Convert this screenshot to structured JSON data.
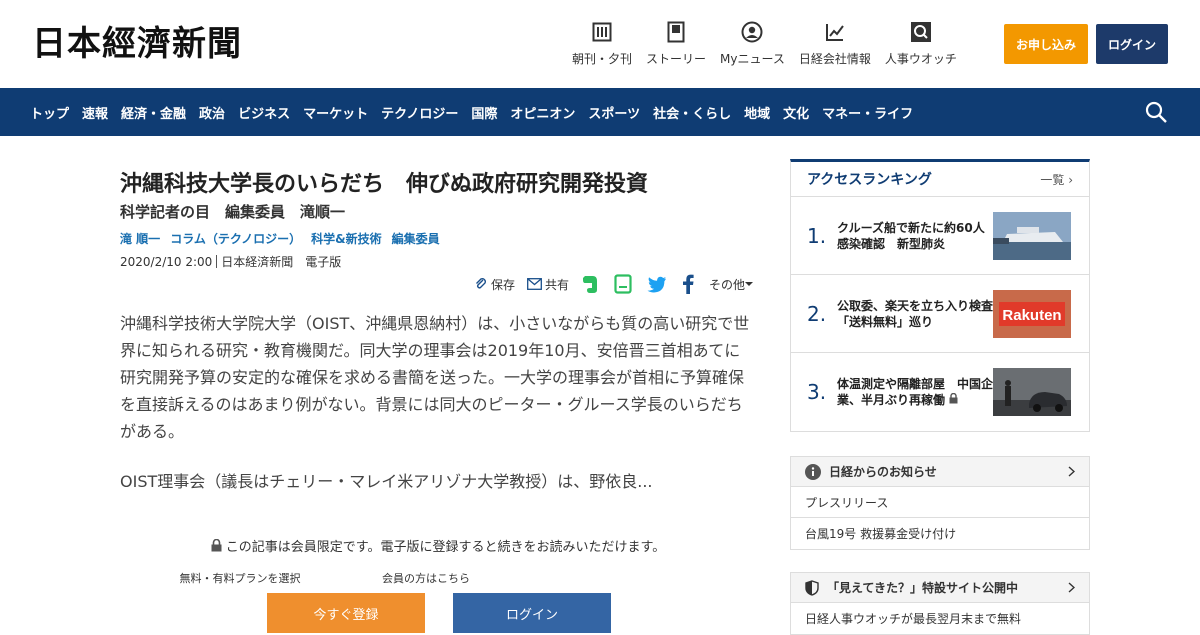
{
  "header": {
    "logo": "日本經濟新聞",
    "nav": [
      {
        "label": "朝刊・夕刊",
        "icon": "newspaper-icon"
      },
      {
        "label": "ストーリー",
        "icon": "story-icon"
      },
      {
        "label": "Myニュース",
        "icon": "user-icon"
      },
      {
        "label": "日経会社情報",
        "icon": "chart-icon"
      },
      {
        "label": "人事ウオッチ",
        "icon": "search-person-icon"
      }
    ],
    "apply_label": "お申し込み",
    "login_label": "ログイン"
  },
  "navbar": {
    "items": [
      "トップ",
      "速報",
      "経済・金融",
      "政治",
      "ビジネス",
      "マーケット",
      "テクノロジー",
      "国際",
      "オピニオン",
      "スポーツ",
      "社会・くらし",
      "地域",
      "文化",
      "マネー・ライフ"
    ]
  },
  "article": {
    "title": "沖縄科技大学長のいらだち　伸びぬ政府研究開発投資",
    "subtitle": "科学記者の目　編集委員　滝順一",
    "tags": [
      "滝 順一",
      "コラム（テクノロジー）",
      "科学&新技術",
      "編集委員"
    ],
    "date": "2020/2/10 2:00",
    "source": "日本経済新聞　電子版",
    "share": {
      "save": "保存",
      "share": "共有",
      "more": "その他"
    },
    "paragraphs": [
      "沖縄科学技術大学院大学（OIST、沖縄県恩納村）は、小さいながらも質の高い研究で世界に知られる研究・教育機関だ。同大学の理事会は2019年10月、安倍晋三首相あてに研究開発予算の安定的な確保を求める書簡を送った。一大学の理事会が首相に予算確保を直接訴えるのはあまり例がない。背景には同大のピーター・グルース学長のいらだちがある。",
      "OIST理事会（議長はチェリー・マレイ米アリゾナ大学教授）は、野依良..."
    ],
    "paywall_msg": "この記事は会員限定です。電子版に登録すると続きをお読みいただけます。",
    "plan_label": "無料・有料プランを選択",
    "member_label": "会員の方はこちら",
    "register_btn": "今すぐ登録",
    "login_btn": "ログイン"
  },
  "ranking": {
    "title": "アクセスランキング",
    "all_label": "一覧",
    "items": [
      {
        "rank": "1.",
        "text": "クルーズ船で新たに約60人感染確認　新型肺炎"
      },
      {
        "rank": "2.",
        "text": "公取委、楽天を立ち入り検査　「送料無料」巡り",
        "thumb_text": "Rakuten"
      },
      {
        "rank": "3.",
        "text": "体温測定や隔離部屋　中国企業、半月ぶり再稼働"
      }
    ]
  },
  "notice": {
    "title": "日経からのお知らせ",
    "rows": [
      "プレスリリース",
      "台風19号 救援募金受け付け"
    ]
  },
  "special": {
    "title": "「見えてきた？」特設サイト公開中",
    "row": "日経人事ウオッチが最長翌月末まで無料"
  }
}
